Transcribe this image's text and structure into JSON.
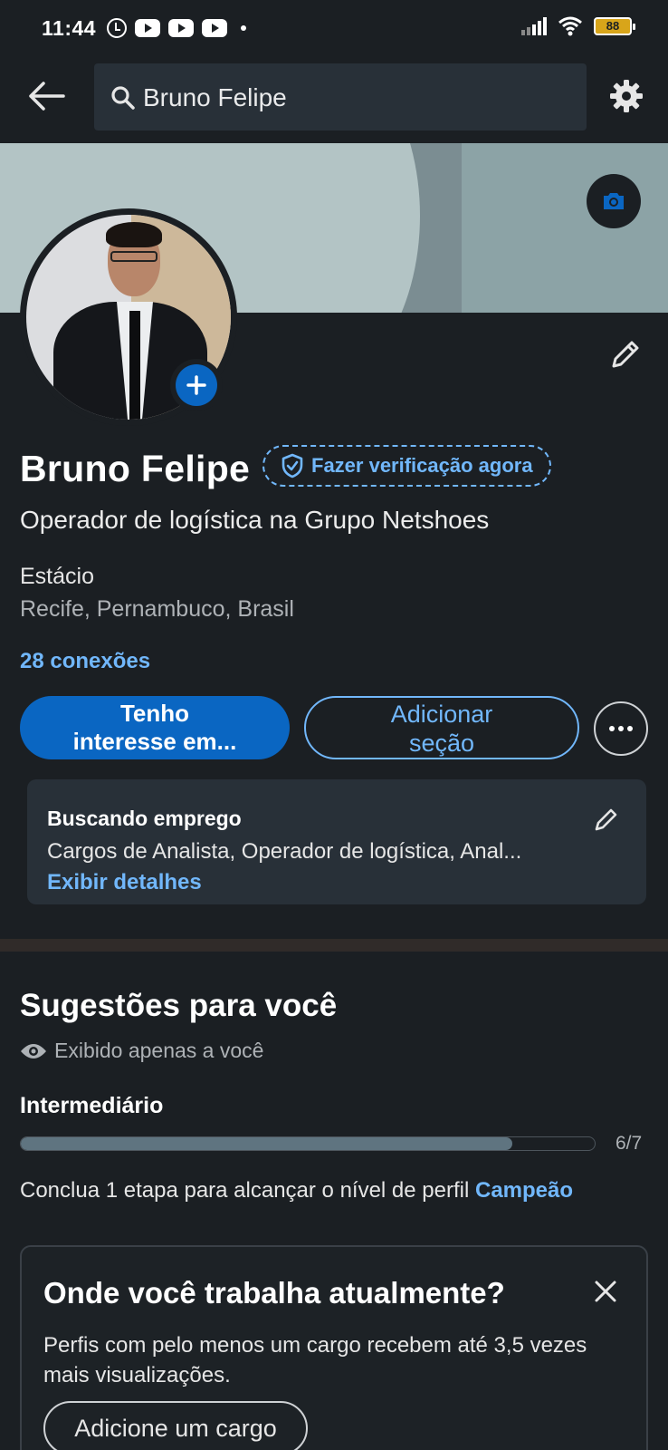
{
  "status_bar": {
    "time": "11:44",
    "battery": "88",
    "notification_icons": [
      "alarm-icon",
      "youtube-icon",
      "youtube-icon",
      "youtube-icon"
    ]
  },
  "app_bar": {
    "search_value": "Bruno Felipe"
  },
  "profile": {
    "name": "Bruno Felipe",
    "verify_label": "Fazer verificação agora",
    "headline": "Operador de logística na Grupo Netshoes",
    "school": "Estácio",
    "location": "Recife, Pernambuco, Brasil",
    "connections": "28 conexões"
  },
  "actions": {
    "primary_line1": "Tenho",
    "primary_line2": "interesse em...",
    "secondary_line1": "Adicionar",
    "secondary_line2": "seção"
  },
  "open_to_work": {
    "title": "Buscando emprego",
    "description": "Cargos de Analista, Operador de logística, Anal...",
    "link": "Exibir detalhes"
  },
  "suggestions": {
    "title": "Sugestões para você",
    "private_note": "Exibido apenas a você",
    "level": "Intermediário",
    "progress_value": 6,
    "progress_total": 7,
    "progress_label": "6/7",
    "next_level_text": "Conclua 1 etapa para alcançar o nível de perfil ",
    "next_level_name": "Campeão"
  },
  "card": {
    "question": "Onde você trabalha atualmente?",
    "text": "Perfis com pelo menos um cargo recebem até 3,5 vezes mais visualizações.",
    "button": "Adicione um cargo"
  },
  "colors": {
    "background": "#1b1f23",
    "accent_blue": "#0a66c2",
    "link_blue": "#71b7fb"
  }
}
